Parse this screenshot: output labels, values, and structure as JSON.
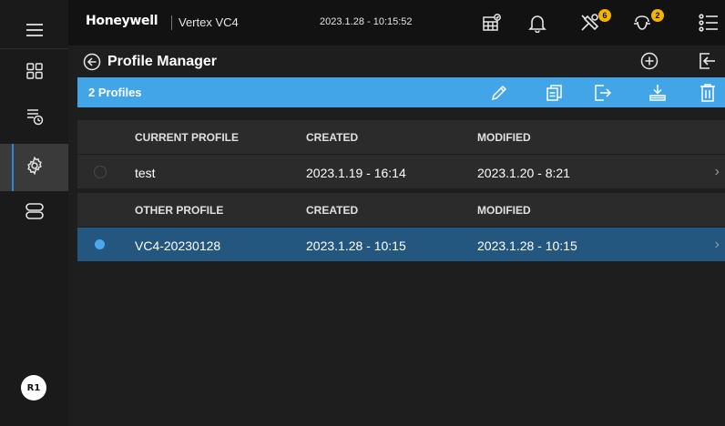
{
  "topbar": {
    "brand": "Honeywell",
    "product": "Vertex VC4",
    "datetime": "2023.1.28 - 10:15:52",
    "icons": [
      {
        "name": "calendar-icon"
      },
      {
        "name": "bell-icon"
      },
      {
        "name": "tools-icon",
        "badge": "6"
      },
      {
        "name": "gas-icon",
        "badge": "2"
      },
      {
        "name": "list-menu-icon"
      }
    ]
  },
  "rail": {
    "items": [
      "hamburger-menu-icon",
      "grid-icon",
      "event-log-icon",
      "settings-icon",
      "storage-icon"
    ],
    "user_initials": "R1"
  },
  "header": {
    "title": "Profile Manager"
  },
  "toolbar": {
    "count_label": "2 Profiles",
    "actions": [
      "edit-icon",
      "copy-icon",
      "export-icon",
      "download-icon",
      "delete-icon"
    ]
  },
  "current_section": {
    "columns": [
      "CURRENT PROFILE",
      "CREATED",
      "MODIFIED"
    ],
    "rows": [
      {
        "name": "test",
        "created": "2023.1.19 - 16:14",
        "modified": "2023.1.20 - 8:21",
        "selected": false
      }
    ]
  },
  "other_section": {
    "columns": [
      "OTHER PROFILE",
      "CREATED",
      "MODIFIED"
    ],
    "rows": [
      {
        "name": "VC4-20230128",
        "created": "2023.1.28 - 10:15",
        "modified": "2023.1.28 - 10:15",
        "selected": true
      }
    ]
  },
  "colors": {
    "accent_blue": "#42a5e8",
    "selected_row": "#24577f",
    "badge_yellow": "#f2b400"
  }
}
